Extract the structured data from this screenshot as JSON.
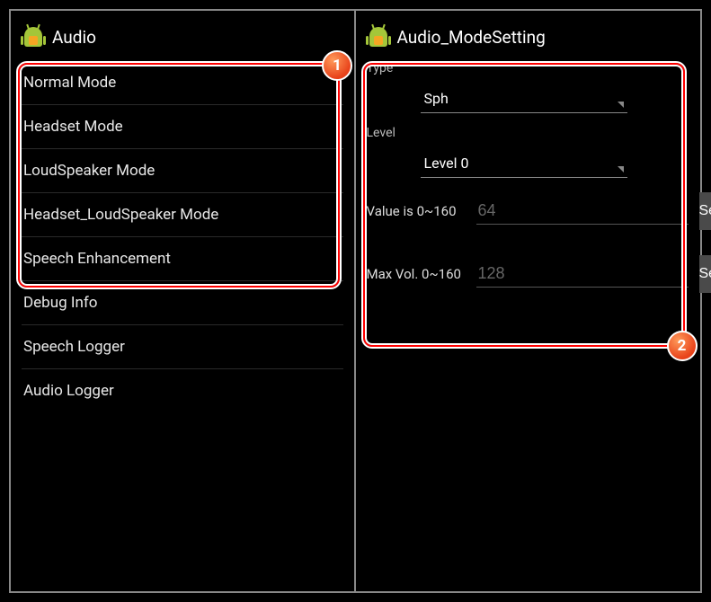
{
  "left": {
    "title": "Audio",
    "badge": "1",
    "items": [
      "Normal Mode",
      "Headset Mode",
      "LoudSpeaker Mode",
      "Headset_LoudSpeaker Mode",
      "Speech Enhancement",
      "Debug Info",
      "Speech Logger",
      "Audio Logger"
    ]
  },
  "right": {
    "title": "Audio_ModeSetting",
    "badge": "2",
    "type_label": "Type",
    "type_value": "Sph",
    "level_label": "Level",
    "level_value": "Level 0",
    "value_label": "Value is 0~160",
    "value_input": "64",
    "max_label": "Max Vol. 0~160",
    "max_input": "128",
    "set_label": "Set"
  }
}
